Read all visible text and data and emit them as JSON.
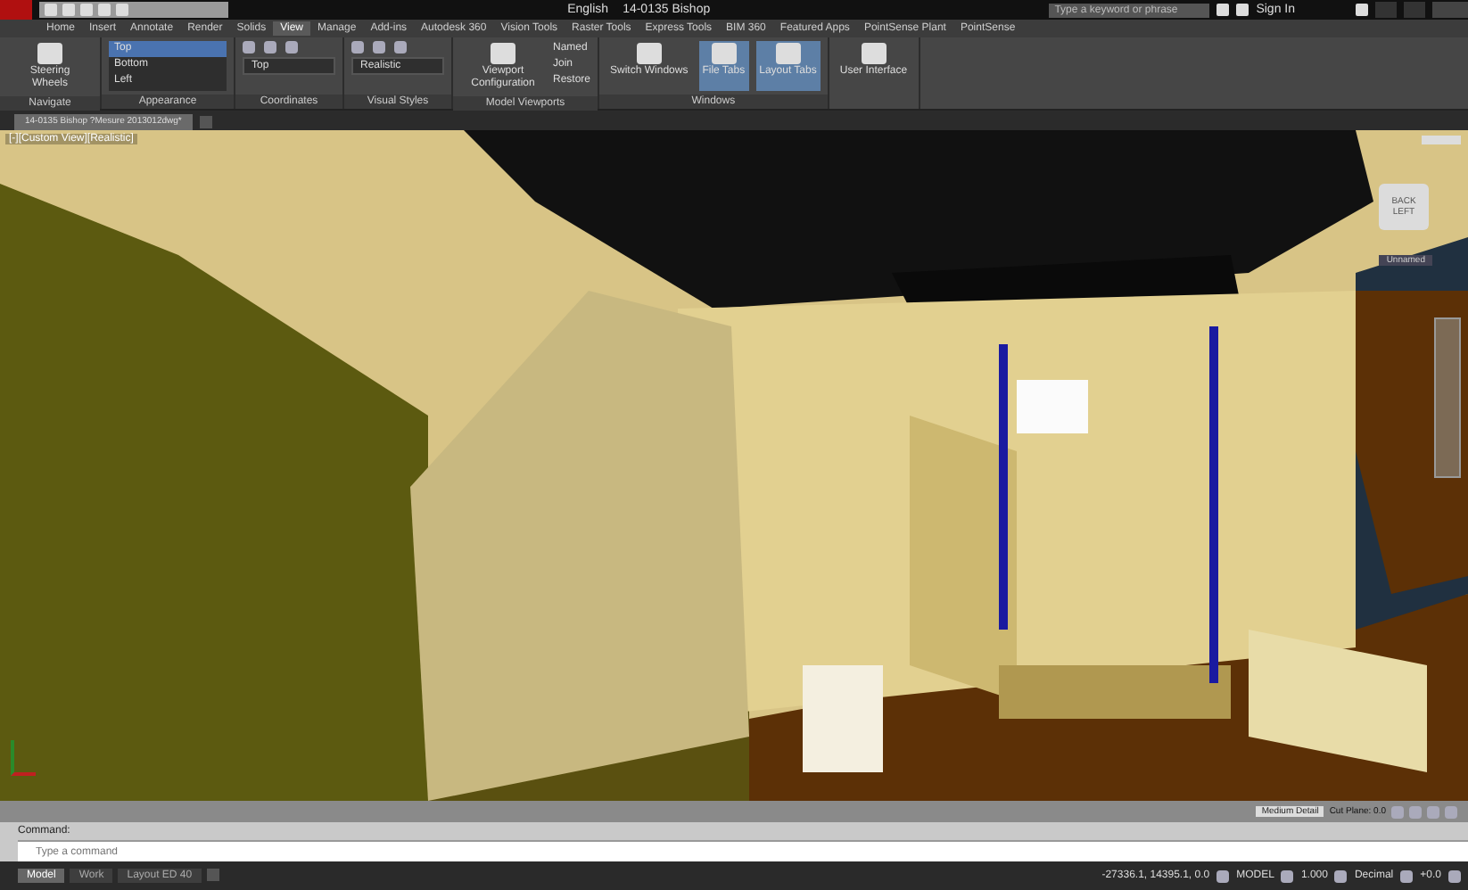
{
  "title_bar": {
    "document": "14-0135 Bishop",
    "language": "English",
    "search": {
      "placeholder": "Type a keyword or phrase"
    },
    "sign_in": "Sign In"
  },
  "ribbon_tabs": [
    {
      "label": "Home",
      "selected": false
    },
    {
      "label": "Insert",
      "selected": false
    },
    {
      "label": "Annotate",
      "selected": false
    },
    {
      "label": "Render",
      "selected": false
    },
    {
      "label": "Solids",
      "selected": false
    },
    {
      "label": "View",
      "selected": true
    },
    {
      "label": "Manage",
      "selected": false
    },
    {
      "label": "Add-ins",
      "selected": false
    },
    {
      "label": "Autodesk 360",
      "selected": false
    },
    {
      "label": "Vision Tools",
      "selected": false
    },
    {
      "label": "Raster Tools",
      "selected": false
    },
    {
      "label": "Express Tools",
      "selected": false
    },
    {
      "label": "BIM 360",
      "selected": false
    },
    {
      "label": "Featured Apps",
      "selected": false
    },
    {
      "label": "PointSense Plant",
      "selected": false
    },
    {
      "label": "PointSense",
      "selected": false
    }
  ],
  "ribbon_panels": [
    {
      "title": "Navigate",
      "items": [
        {
          "kind": "large",
          "label": "Steering Wheels"
        }
      ]
    },
    {
      "title": "Appearance",
      "items": [
        {
          "kind": "list",
          "entries": [
            {
              "label": "Top",
              "selected": true
            },
            {
              "label": "Bottom",
              "selected": false
            },
            {
              "label": "Left",
              "selected": false
            }
          ]
        }
      ]
    },
    {
      "title": "Coordinates",
      "items": [
        {
          "kind": "dropdown",
          "value": "Top"
        }
      ]
    },
    {
      "title": "Visual Styles",
      "items": [
        {
          "kind": "dropdown",
          "value": "Realistic"
        }
      ]
    },
    {
      "title": "Model Viewports",
      "items": [
        {
          "kind": "large",
          "label": "Viewport Configuration"
        },
        {
          "kind": "small",
          "labels": [
            "Named",
            "Join",
            "Restore"
          ]
        }
      ]
    },
    {
      "title": "Windows",
      "items": [
        {
          "kind": "large",
          "label": "Switch Windows"
        },
        {
          "kind": "toggle",
          "label": "File Tabs",
          "selected": true
        },
        {
          "kind": "toggle",
          "label": "Layout Tabs",
          "selected": true
        }
      ]
    },
    {
      "items": [
        {
          "kind": "large",
          "label": "User Interface"
        }
      ]
    }
  ],
  "file_tabs": [
    {
      "label": "14-0135 Bishop ?Mesure 2013012dwg*",
      "selected": true
    }
  ],
  "viewport": {
    "label": "[-][Custom View][Realistic]",
    "viewcube": {
      "faces": [
        "BACK",
        "LEFT"
      ],
      "view_name": "Unnamed"
    },
    "detail": "Medium Detail",
    "cut_plane": "Cut Plane: 0.0"
  },
  "command_line": {
    "history": "Command:",
    "placeholder": "Type a command"
  },
  "layout_tabs": [
    {
      "label": "Model",
      "selected": true
    },
    {
      "label": "Work",
      "selected": false
    },
    {
      "label": "Layout ED 40",
      "selected": false
    }
  ],
  "status_bar": {
    "coordinates": "-27336.1, 14395.1, 0.0",
    "items": [
      "MODEL",
      "1.000",
      "Decimal",
      "+0.0"
    ]
  }
}
